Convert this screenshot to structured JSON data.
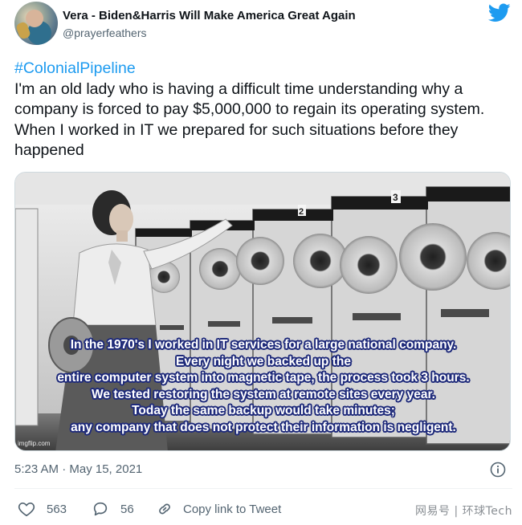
{
  "tweet": {
    "display_name": "Vera - Biden&Harris Will Make America Great Again",
    "handle": "@prayerfeathers",
    "hashtag": "#ColonialPipeline",
    "body": "I'm an old lady who is having a difficult time understanding why a company is forced to pay $5,000,000 to regain its operating system. When I worked in IT we prepared for such situations before they happened",
    "timestamp": "5:23 AM · May 15, 2021",
    "colors": {
      "link": "#1d9bf0",
      "muted": "#536471",
      "twitter_blue": "#1d9bf0"
    }
  },
  "media": {
    "caption_lines": [
      "In the 1970's I worked in IT services for a large national company.",
      "Every night we backed up the",
      "entire computer system into magnetic tape, the process took 3 hours.",
      "We tested restoring the system at remote sites every year.",
      "Today the same backup would take minutes;",
      "any company that does not protect their information is negligent."
    ],
    "watermark": "imgflip.com",
    "cabinet_numbers": [
      "2",
      "3"
    ]
  },
  "actions": {
    "likes": "563",
    "replies": "56",
    "copy_link_label": "Copy link to Tweet"
  },
  "icons": [
    "twitter-bird-icon",
    "info-icon",
    "heart-icon",
    "reply-icon",
    "link-icon"
  ],
  "source_watermark": "网易号 | 环球Tech"
}
